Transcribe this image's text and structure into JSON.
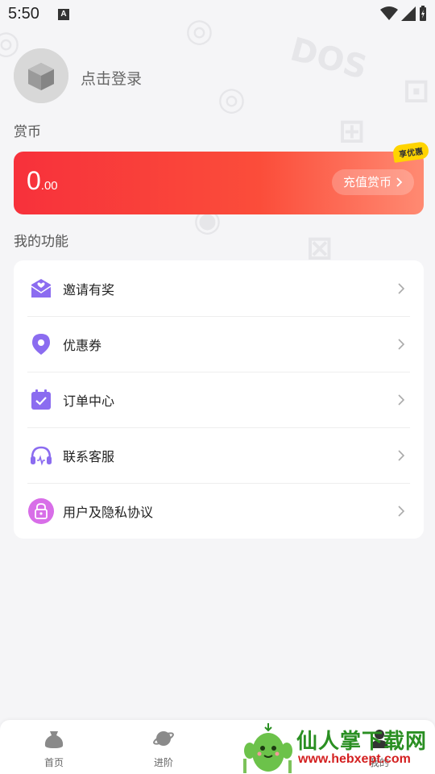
{
  "status_bar": {
    "time": "5:50",
    "notification_glyph": "A"
  },
  "profile": {
    "login_text": "点击登录"
  },
  "coins": {
    "section_label": "赏币",
    "amount_int": "0",
    "amount_dec": ".00",
    "recharge_label": "充值赏币",
    "promo_badge": "享优惠"
  },
  "functions": {
    "section_label": "我的功能",
    "items": [
      {
        "label": "邀请有奖",
        "icon": "gift-mail-icon"
      },
      {
        "label": "优惠券",
        "icon": "location-pin-icon"
      },
      {
        "label": "订单中心",
        "icon": "calendar-check-icon"
      },
      {
        "label": "联系客服",
        "icon": "headset-icon"
      },
      {
        "label": "用户及隐私协议",
        "icon": "lock-icon"
      }
    ]
  },
  "bottom_nav": {
    "items": [
      {
        "label": "首页",
        "icon": "bag-icon"
      },
      {
        "label": "进阶",
        "icon": "planet-icon"
      },
      {
        "label": "我的",
        "icon": "user-icon"
      }
    ]
  },
  "watermark": {
    "title": "仙人掌下载网",
    "url": "www.hebxept.com"
  },
  "colors": {
    "accent_red": "#f7313b",
    "icon_purple": "#8b6cf0",
    "background": "#f5f5f7"
  }
}
